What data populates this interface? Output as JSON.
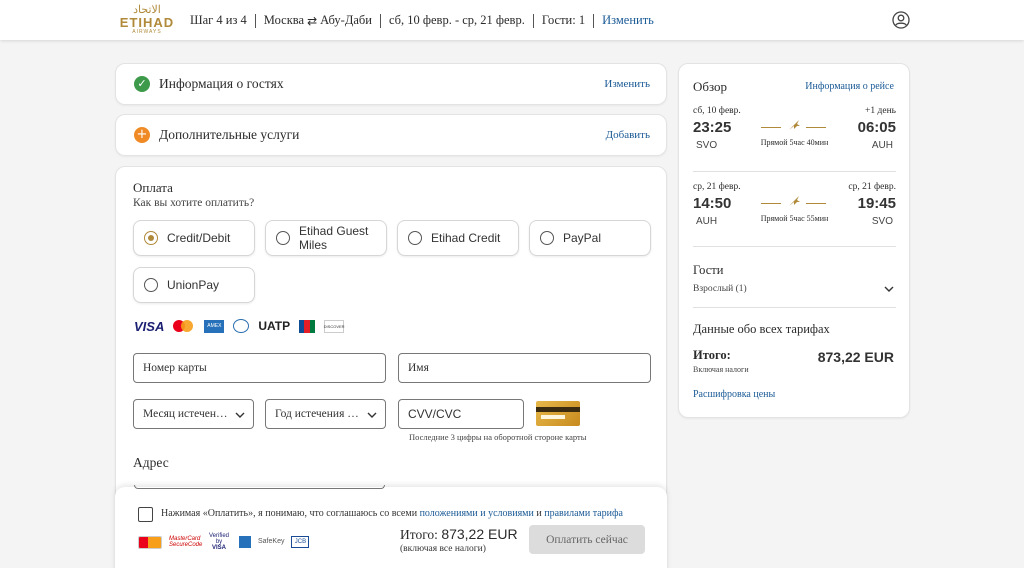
{
  "brand": {
    "logo_arabic": "الاتحاد",
    "logo_text": "ETIHAD",
    "logo_sub": "AIRWAYS",
    "gold": "#b08a3a",
    "link_blue": "#1a5a96"
  },
  "header": {
    "step": "Шаг 4 из 4",
    "origin": "Москва",
    "destination": "Абу-Даби",
    "dates": "сб, 10 февр. - ср, 21 февр.",
    "guests": "Гости: 1",
    "change": "Изменить"
  },
  "guests_section": {
    "title": "Информация о гостях",
    "action": "Изменить"
  },
  "extras_section": {
    "title": "Дополнительные услуги",
    "action": "Добавить"
  },
  "payment": {
    "title": "Оплата",
    "question": "Как вы хотите оплатить?",
    "options": [
      {
        "label": "Credit/Debit",
        "selected": true
      },
      {
        "label": "Etihad Guest Miles",
        "selected": false
      },
      {
        "label": "Etihad Credit",
        "selected": false
      },
      {
        "label": "PayPal",
        "selected": false
      },
      {
        "label": "UnionPay",
        "selected": false
      }
    ],
    "card_logos": {
      "visa": "VISA",
      "uatp": "UATP",
      "amex": "AMEX",
      "discover": "DISCOVER"
    },
    "fields": {
      "card_number": "Номер карты",
      "name": "Имя",
      "expiry_month": "Месяц истечения срока",
      "expiry_year": "Год истечения срока",
      "cvv": "CVV/CVC"
    },
    "cvv_hint": "Последние 3 цифры на оборотной стороне карты",
    "address_title": "Адрес"
  },
  "footer": {
    "terms_prefix": "Нажимая «Оплатить», я понимаю, что соглашаюсь со всеми",
    "terms_link": "положениями и условиями",
    "terms_and": "и",
    "fare_rules_link": "правилами тарифа",
    "seals": {
      "mastercard": "MasterCard SecureCode",
      "verified_by": "Verified by",
      "verified_visa": "VISA",
      "safekey": "SafeKey",
      "jcb": "JCB"
    },
    "total_label": "Итого:",
    "total_value": "873,22 EUR",
    "taxes_note": "(включая все налоги)",
    "pay_button": "Оплатить сейчас"
  },
  "summary": {
    "title": "Обзор",
    "flight_info_link": "Информация о рейсе",
    "outbound": {
      "dep_date": "сб, 10 февр.",
      "arr_note": "+1 день",
      "dep_time": "23:25",
      "arr_time": "06:05",
      "dep_code": "SVO",
      "arr_code": "AUH",
      "duration": "Прямой 5час 40мин"
    },
    "inbound": {
      "dep_date": "ср, 21 февр.",
      "arr_date": "ср, 21 февр.",
      "dep_time": "14:50",
      "arr_time": "19:45",
      "dep_code": "AUH",
      "arr_code": "SVO",
      "duration": "Прямой 5час 55мин"
    },
    "guests_title": "Гости",
    "guests_row": "Взрослый (1)",
    "fares_title": "Данные обо всех тарифах",
    "total_label": "Итого:",
    "total_value": "873,22 EUR",
    "taxes_note": "Включая налоги",
    "breakdown_link": "Расшифровка цены"
  }
}
